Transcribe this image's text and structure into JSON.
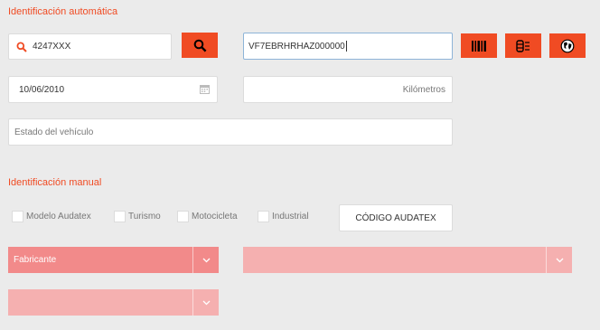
{
  "auto": {
    "title": "Identificación automática",
    "plate_value": "4247XXX",
    "vin_value": "VF7EBRHRHAZ000000",
    "date_value": "10/06/2010",
    "km_placeholder": "Kilómetros",
    "state_placeholder": "Estado del vehículo",
    "icons": {
      "search_field": "search-icon",
      "search_button": "search-icon",
      "barcode": "barcode-icon",
      "vehicle_scan": "car-scan-icon",
      "globe": "globe-icon",
      "calendar": "calendar-icon"
    }
  },
  "manual": {
    "title": "Identificación manual",
    "checkboxes": [
      "Modelo Audatex",
      "Turismo",
      "Motocicleta",
      "Industrial"
    ],
    "audatex_code_label": "CÓDIGO AUDATEX",
    "selects": {
      "manufacturer": "Fabricante",
      "second": "",
      "third": ""
    }
  },
  "colors": {
    "accent": "#f04b23",
    "background": "#ebebeb",
    "select_primary": "#f28a8a",
    "select_light": "#f5b0b0",
    "vin_focus_border": "#8eb4d8"
  }
}
